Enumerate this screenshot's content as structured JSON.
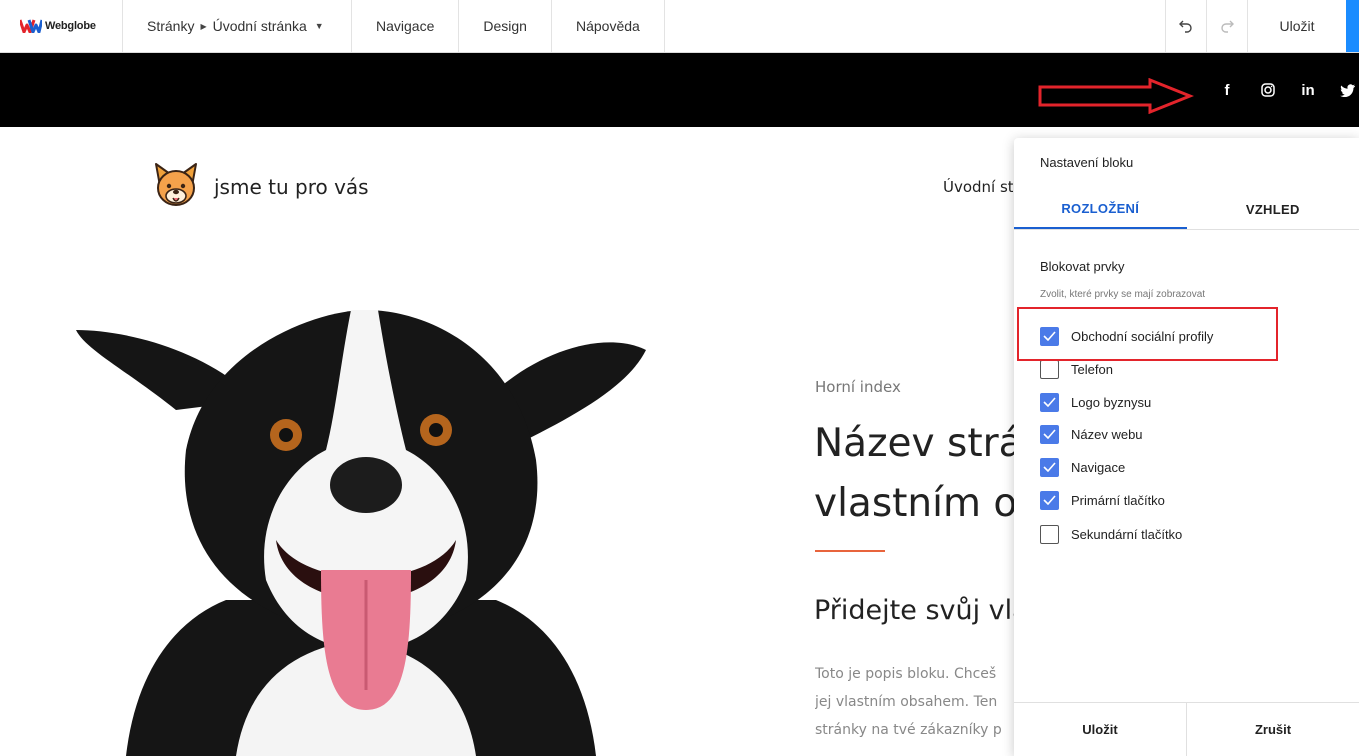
{
  "toolbar": {
    "brand": "Webglobe",
    "pages_label": "Stránky",
    "current_page": "Úvodní stránka",
    "navigation": "Navigace",
    "design": "Design",
    "help": "Nápověda",
    "save": "Uložit",
    "icons": [
      "webglobe-logo-icon",
      "undo-icon",
      "redo-icon"
    ]
  },
  "social_bar": {
    "icons": [
      "facebook-icon",
      "instagram-icon",
      "linkedin-icon",
      "twitter-icon"
    ],
    "facebook_glyph": "f",
    "linkedin_glyph": "in"
  },
  "site": {
    "name": "jsme tu pro vás",
    "nav_first": "Úvodní stránka"
  },
  "hero": {
    "label": "Horní index",
    "title_line1": "Název stránky",
    "title_line2": "vlastním obsahem",
    "subtitle": "Přidejte svůj vlastní",
    "desc": [
      "Toto je popis bloku. Chceš",
      "jej vlastním obsahem. Ten",
      "stránky na tvé zákazníky p"
    ]
  },
  "panel": {
    "title": "Nastavení bloku",
    "tabs": [
      {
        "label": "ROZLOŽENÍ",
        "active": true
      },
      {
        "label": "VZHLED",
        "active": false
      }
    ],
    "section_title": "Blokovat prvky",
    "section_hint": "Zvolit, které prvky se mají zobrazovat",
    "options": [
      {
        "label": "Obchodní sociální profily",
        "checked": true
      },
      {
        "label": "Telefon",
        "checked": false
      },
      {
        "label": "Logo byznysu",
        "checked": true
      },
      {
        "label": "Název webu",
        "checked": true
      },
      {
        "label": "Navigace",
        "checked": true
      },
      {
        "label": "Primární tlačítko",
        "checked": true
      },
      {
        "label": "Sekundární tlačítko",
        "checked": false
      }
    ],
    "save": "Uložit",
    "cancel": "Zrušit"
  },
  "colors": {
    "accent_blue": "#1a5fd0",
    "checkbox_blue": "#4a7ae8",
    "toolbar_blue": "#1a8cff",
    "annotation_red": "#e3242b",
    "rule_orange": "#e8643c"
  }
}
